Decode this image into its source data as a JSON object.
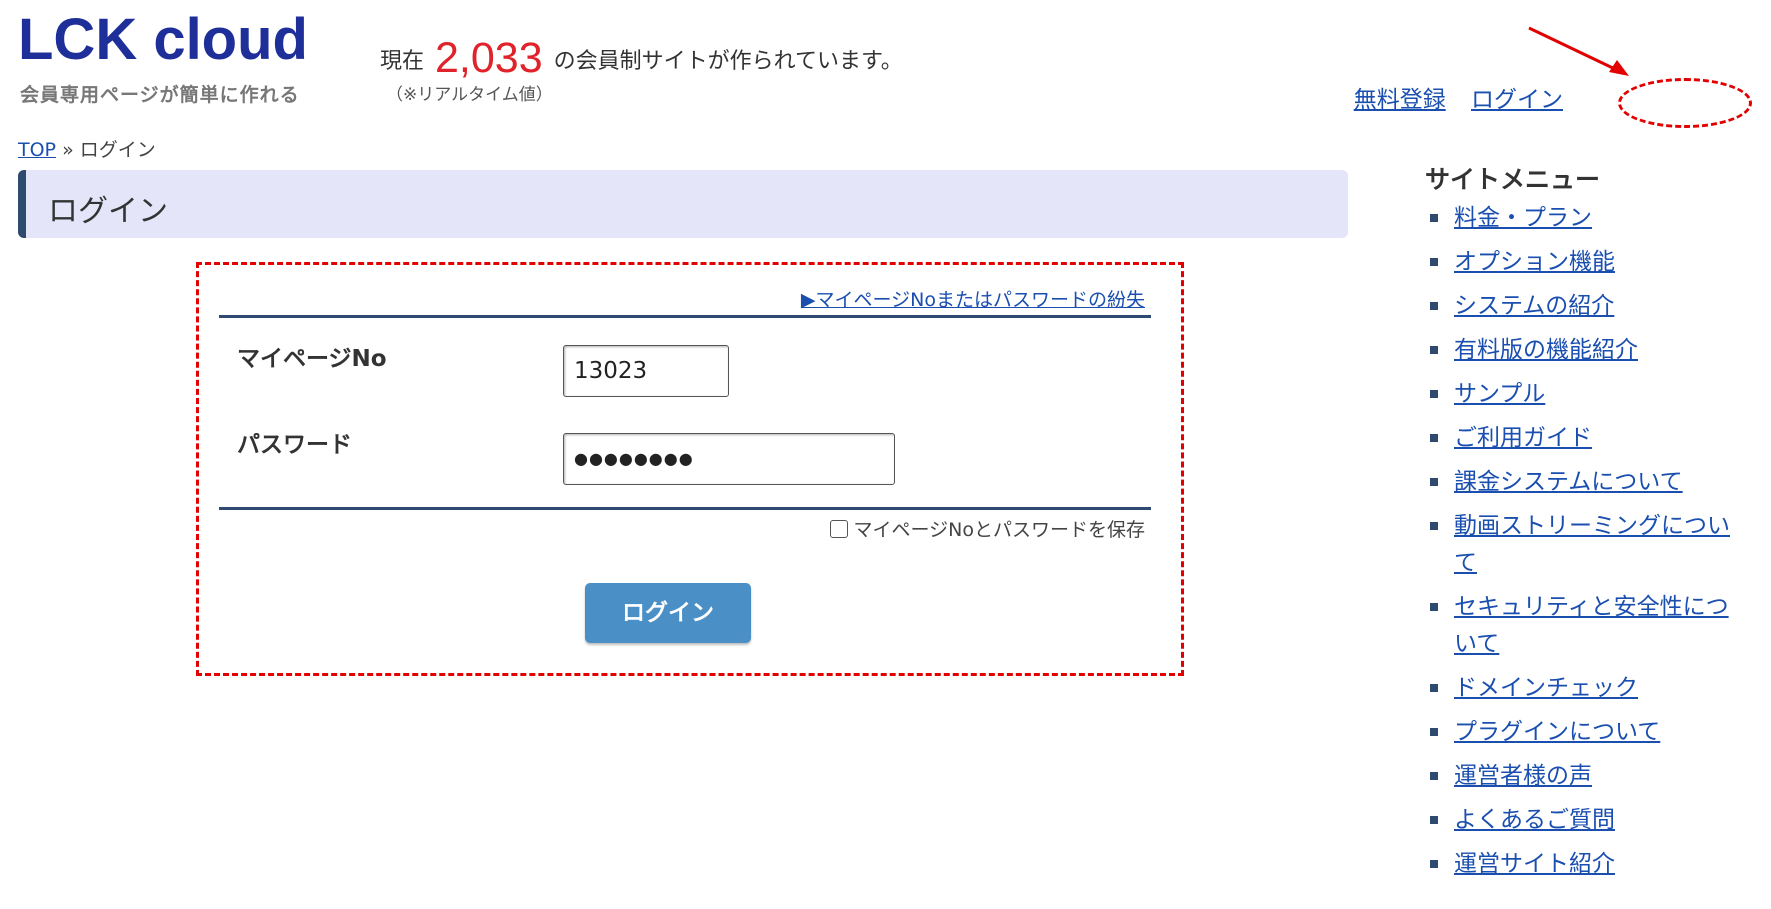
{
  "header": {
    "logo": "LCK cloud",
    "tagline": "会員専用ページが簡単に作れる",
    "count_prefix": "現在",
    "count_value": "2,033",
    "count_suffix": "の会員制サイトが作られています。",
    "realtime_note": "（※リアルタイム値）",
    "links": {
      "register": "無料登録",
      "login": "ログイン"
    }
  },
  "breadcrumb": {
    "top": "TOP",
    "separator": "»",
    "current": "ログイン"
  },
  "page_title": "ログイン",
  "form": {
    "lost_link": "▶マイページNoまたはパスワードの紛失",
    "mypage_label": "マイページNo",
    "mypage_value": "13023",
    "password_label": "パスワード",
    "password_value": "●●●●●●●●",
    "save_label": "マイページNoとパスワードを保存",
    "save_checked": false,
    "submit_label": "ログイン"
  },
  "sidebar": {
    "title": "サイトメニュー",
    "items": [
      {
        "label": "料金・プラン"
      },
      {
        "label": "オプション機能"
      },
      {
        "label": "システムの紹介"
      },
      {
        "label": "有料版の機能紹介"
      },
      {
        "label": "サンプル"
      },
      {
        "label": "ご利用ガイド"
      },
      {
        "label": "課金システムについて"
      },
      {
        "label": "動画ストリーミングについて"
      },
      {
        "label": "セキュリティと安全性について"
      },
      {
        "label": "ドメインチェック"
      },
      {
        "label": "プラグインについて"
      },
      {
        "label": "運営者様の声"
      },
      {
        "label": "よくあるご質問"
      },
      {
        "label": "運営サイト紹介"
      }
    ]
  },
  "colors": {
    "brand": "#1f2f9a",
    "count": "#e0232a",
    "accent_dark": "#2e4a6e",
    "title_bg": "#e4e5f8",
    "button": "#4a8fc5",
    "annotation": "#e30000"
  }
}
